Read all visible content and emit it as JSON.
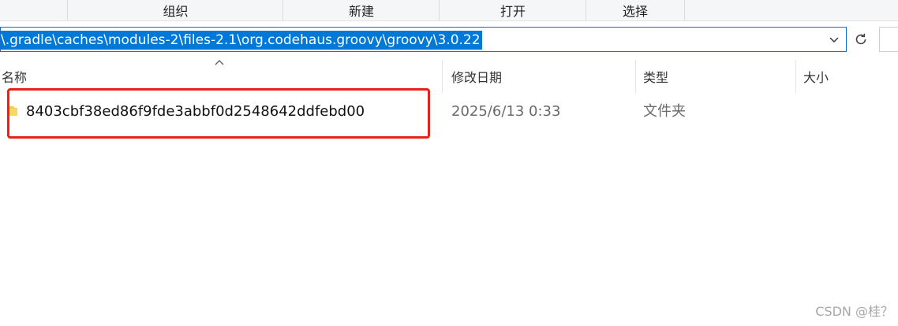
{
  "ribbon": {
    "groups": [
      "组织",
      "新建",
      "打开",
      "选择"
    ]
  },
  "address": {
    "path": "\\.gradle\\caches\\modules-2\\files-2.1\\org.codehaus.groovy\\groovy\\3.0.22"
  },
  "columns": {
    "name": "名称",
    "modified": "修改日期",
    "type": "类型",
    "size": "大小"
  },
  "files": [
    {
      "name": "8403cbf38ed86f9fde3abbf0d2548642ddfebd00",
      "modified": "2025/6/13 0:33",
      "type": "文件夹",
      "icon": "folder-icon"
    }
  ],
  "watermark": "CSDN @桂？",
  "colors": {
    "selection": "#0078d7",
    "highlight_box": "#e8221b",
    "folder": "#f7c948"
  }
}
